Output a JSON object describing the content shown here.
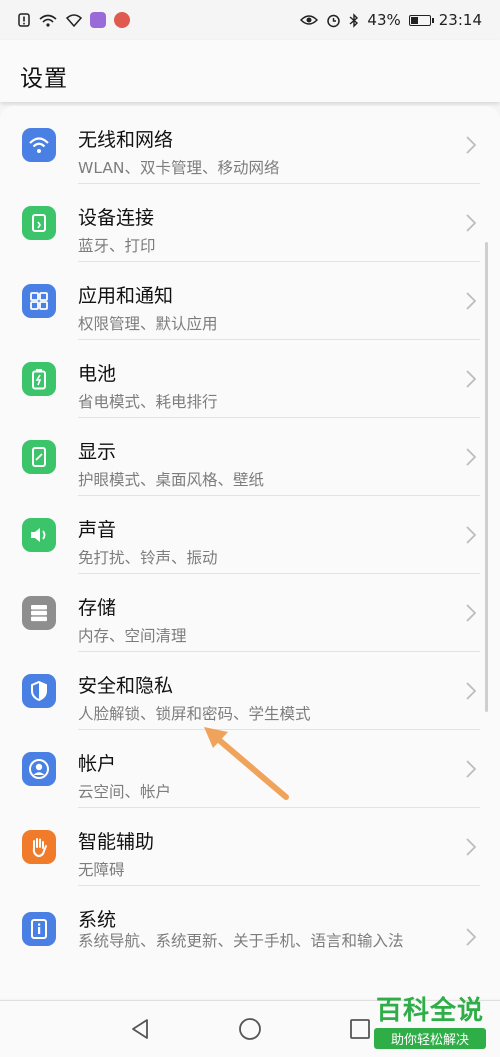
{
  "status_bar": {
    "time": "23:14",
    "battery_text": "43%",
    "battery_level": 0.43,
    "left_icons": [
      "alert-icon",
      "wifi-signal-icon",
      "wifi-icon",
      "app-purple-icon",
      "app-red-icon"
    ],
    "right_icons": [
      "eye-icon",
      "alarm-icon",
      "bluetooth-icon",
      "battery-icon"
    ]
  },
  "header": {
    "title": "设置"
  },
  "settings": [
    {
      "title": "无线和网络",
      "subtitle": "WLAN、双卡管理、移动网络",
      "icon": "wifi-icon",
      "color": "#4a7fe3"
    },
    {
      "title": "设备连接",
      "subtitle": "蓝牙、打印",
      "icon": "device-connect-icon",
      "color": "#3cc46a"
    },
    {
      "title": "应用和通知",
      "subtitle": "权限管理、默认应用",
      "icon": "apps-grid-icon",
      "color": "#4a7fe3"
    },
    {
      "title": "电池",
      "subtitle": "省电模式、耗电排行",
      "icon": "battery-icon",
      "color": "#3cc46a"
    },
    {
      "title": "显示",
      "subtitle": "护眼模式、桌面风格、壁纸",
      "icon": "display-icon",
      "color": "#3cc46a"
    },
    {
      "title": "声音",
      "subtitle": "免打扰、铃声、振动",
      "icon": "speaker-icon",
      "color": "#3cc46a"
    },
    {
      "title": "存储",
      "subtitle": "内存、空间清理",
      "icon": "storage-icon",
      "color": "#8e8e8e"
    },
    {
      "title": "安全和隐私",
      "subtitle": "人脸解锁、锁屏和密码、学生模式",
      "icon": "shield-icon",
      "color": "#4a7fe3"
    },
    {
      "title": "帐户",
      "subtitle": "云空间、帐户",
      "icon": "account-icon",
      "color": "#4a7fe3"
    },
    {
      "title": "智能辅助",
      "subtitle": "无障碍",
      "icon": "hand-icon",
      "color": "#f07b2a"
    },
    {
      "title": "系统",
      "subtitle": "系统导航、系统更新、关于手机、语言和输入法",
      "icon": "info-icon",
      "color": "#4a7fe3"
    }
  ],
  "nav": {
    "icons": [
      "back-icon",
      "home-icon",
      "recents-icon"
    ]
  },
  "watermark": {
    "title": "百科全说",
    "subtitle": "助你轻松解决"
  },
  "annotation": {
    "arrow_color": "#f0a35b"
  }
}
